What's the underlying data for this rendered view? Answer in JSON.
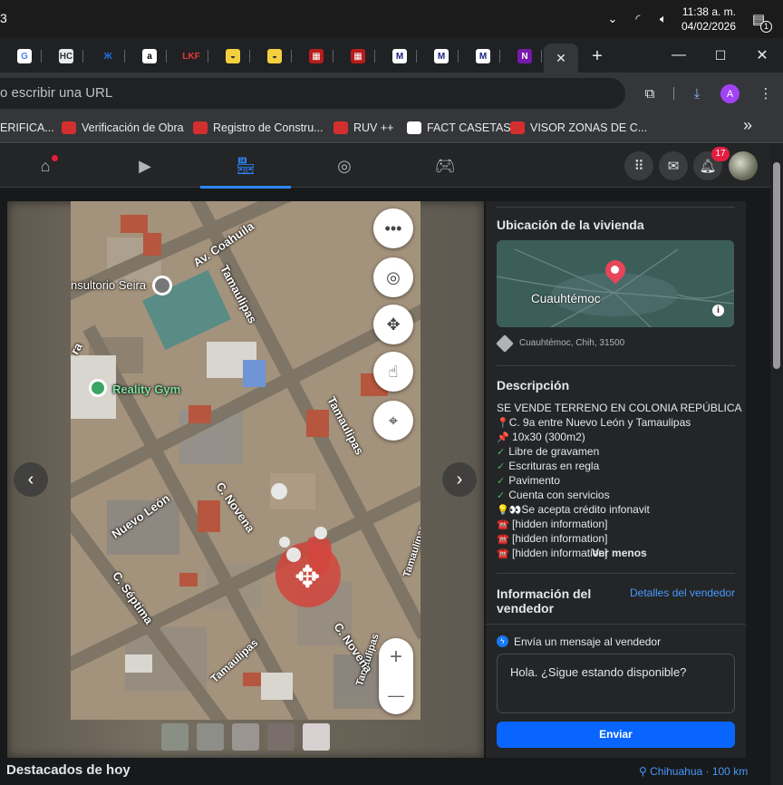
{
  "system": {
    "time": "11:38 a. m.",
    "date": "04/02/2026",
    "notification_count": "1",
    "left_glyph": "3"
  },
  "browser": {
    "tabs": [
      {
        "icon": "google-icon",
        "label": "G",
        "color": "#ffffff",
        "fg": "#4285f4"
      },
      {
        "icon": "site-icon",
        "label": "HC",
        "color": "#e8eaed",
        "fg": "#333"
      },
      {
        "icon": "infonavit-icon",
        "label": "Ж",
        "color": "#202124",
        "fg": "#1a73e8"
      },
      {
        "icon": "amazon-icon",
        "label": "a",
        "color": "#ffffff",
        "fg": "#000"
      },
      {
        "icon": "lkf-icon",
        "label": "LKF",
        "color": "#202124",
        "fg": "#e53935"
      },
      {
        "icon": "cfe-icon",
        "label": "◒",
        "color": "#f4d03f",
        "fg": "#333"
      },
      {
        "icon": "cfe2-icon",
        "label": "◒",
        "color": "#f4d03f",
        "fg": "#333"
      },
      {
        "icon": "red-doc-icon",
        "label": "▦",
        "color": "#b71c1c",
        "fg": "#fff"
      },
      {
        "icon": "red-doc2-icon",
        "label": "▦",
        "color": "#b71c1c",
        "fg": "#fff"
      },
      {
        "icon": "doc-icon",
        "label": "M",
        "color": "#ffffff",
        "fg": "#1a237e"
      },
      {
        "icon": "doc2-icon",
        "label": "M",
        "color": "#ffffff",
        "fg": "#1a237e"
      },
      {
        "icon": "doc3-icon",
        "label": "M",
        "color": "#ffffff",
        "fg": "#1a237e"
      },
      {
        "icon": "onenote-icon",
        "label": "N",
        "color": "#7719aa",
        "fg": "#fff"
      }
    ],
    "close_tab_glyph": "✕",
    "new_tab_glyph": "+",
    "window_buttons": {
      "minimize": "—",
      "maximize": "☐",
      "close": "✕"
    },
    "omnibox_text": "o escribir una URL",
    "profile_initial": "A",
    "bookmarks": [
      {
        "label": "ERIFICA...",
        "icon": "",
        "color": ""
      },
      {
        "label": "Verificación de Obra",
        "icon": "ruv-icon",
        "color": "#d32f2f"
      },
      {
        "label": "Registro de Constru...",
        "icon": "ruv-icon",
        "color": "#d32f2f"
      },
      {
        "label": "RUV ++",
        "icon": "ruv-icon",
        "color": "#d32f2f"
      },
      {
        "label": "FACT CASETAS",
        "icon": "globe-icon",
        "color": "#ffffff"
      },
      {
        "label": "VISOR ZONAS DE C...",
        "icon": "visor-icon",
        "color": "#d32f2f"
      }
    ],
    "bookmarks_more": "»"
  },
  "facebook": {
    "nav": [
      "home-icon",
      "video-icon",
      "marketplace-icon",
      "groups-icon",
      "gaming-icon"
    ],
    "notification_badge": "17"
  },
  "map": {
    "labels": {
      "street1": "Av. Coahuila",
      "street2": "Tamaulipas",
      "street3": "Tamaulipas",
      "street4": "Tamaulipas",
      "street5": "Tamaulipas",
      "street6": "Tamaulipas",
      "street7": "Nuevo León",
      "street8": "C. Novena",
      "street9": "C. Séptima",
      "street10": "C. Novena",
      "poi1": "nsultorio Seira",
      "poi2": "Reality Gym",
      "street11": "ra"
    },
    "zoom_in": "+",
    "zoom_out": "—",
    "thumbnail_colors": [
      "#8a8f86",
      "#8d8e87",
      "#9a9590",
      "#7a6e6a",
      "#d8d0d0"
    ]
  },
  "listing": {
    "location_title": "Ubicación de la vivienda",
    "map_city": "Cuauhtémoc",
    "address": "Cuauhtémoc, Chih, 31500",
    "description_title": "Descripción",
    "description_lines": [
      {
        "prefix": "",
        "text": "SE VENDE TERRENO EN COLONIA REPÚBLICA"
      },
      {
        "prefix": "📍",
        "text": "C. 9a entre Nuevo León y Tamaulipas"
      },
      {
        "prefix": "📌",
        "text": " 10x30 (300m2)"
      },
      {
        "prefix": "✓",
        "text": "Libre de gravamen"
      },
      {
        "prefix": "✓",
        "text": "Escrituras en regla"
      },
      {
        "prefix": "✓",
        "text": "Pavimento"
      },
      {
        "prefix": "✓",
        "text": "Cuenta con servicios"
      },
      {
        "prefix": "💡👀",
        "text": "Se acepta crédito infonavit"
      },
      {
        "prefix": "☎️",
        "text": " [hidden information]"
      },
      {
        "prefix": "☎️",
        "text": " [hidden information]"
      },
      {
        "prefix": "☎️",
        "text": " [hidden information]"
      }
    ],
    "see_less": "Ver menos",
    "seller_title_1": "Información del",
    "seller_title_2": "vendedor",
    "seller_details": "Detalles del vendedor",
    "message_title": "Envía un mensaje al vendedor",
    "message_text": "Hola. ¿Sigue estando disponible?",
    "send_label": "Enviar"
  },
  "footer": {
    "section_title": "Destacados de hoy",
    "location": "Chihuahua · 100 km"
  },
  "colors": {
    "accent": "#2d88ff",
    "send_button": "#0866ff",
    "badge": "#e41e3f"
  }
}
